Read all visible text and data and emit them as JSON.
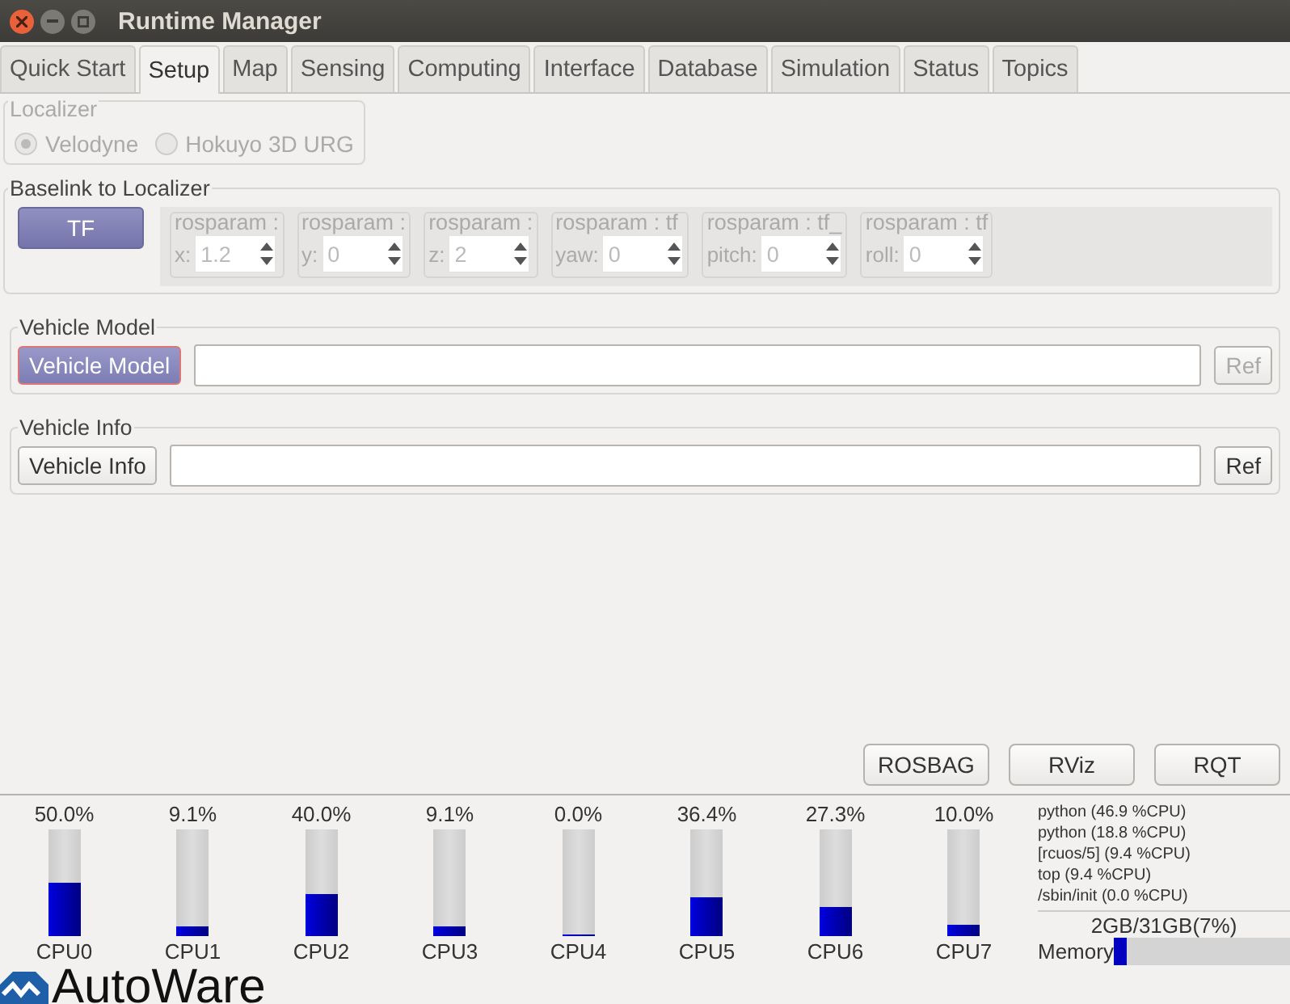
{
  "window": {
    "title": "Runtime Manager"
  },
  "tabs": [
    {
      "label": "Quick Start",
      "selected": false
    },
    {
      "label": "Setup",
      "selected": true
    },
    {
      "label": "Map",
      "selected": false
    },
    {
      "label": "Sensing",
      "selected": false
    },
    {
      "label": "Computing",
      "selected": false
    },
    {
      "label": "Interface",
      "selected": false
    },
    {
      "label": "Database",
      "selected": false
    },
    {
      "label": "Simulation",
      "selected": false
    },
    {
      "label": "Status",
      "selected": false
    },
    {
      "label": "Topics",
      "selected": false
    }
  ],
  "localizer": {
    "title": "Localizer",
    "disabled": true,
    "options": [
      {
        "label": "Velodyne",
        "selected": true
      },
      {
        "label": "Hokuyo 3D URG",
        "selected": false
      }
    ]
  },
  "baselink": {
    "title": "Baselink to Localizer",
    "button": "TF",
    "params": [
      {
        "title": "rosparam :",
        "label": "x:",
        "value": "1.2"
      },
      {
        "title": "rosparam :",
        "label": "y:",
        "value": "0"
      },
      {
        "title": "rosparam :",
        "label": "z:",
        "value": "2"
      },
      {
        "title": "rosparam : tf",
        "label": "yaw:",
        "value": "0"
      },
      {
        "title": "rosparam : tf_",
        "label": "pitch:",
        "value": "0"
      },
      {
        "title": "rosparam : tf",
        "label": "roll:",
        "value": "0"
      }
    ]
  },
  "vehicle_model": {
    "title": "Vehicle Model",
    "button": "Vehicle Model",
    "highlighted": true,
    "ref": "Ref",
    "ref_disabled": true
  },
  "vehicle_info": {
    "title": "Vehicle Info",
    "button": "Vehicle Info",
    "highlighted": false,
    "ref": "Ref",
    "ref_disabled": false
  },
  "tools": [
    "ROSBAG",
    "RViz",
    "RQT"
  ],
  "cpus": [
    {
      "percent": "50.0%",
      "level": 0.5,
      "name": "CPU0"
    },
    {
      "percent": "9.1%",
      "level": 0.091,
      "name": "CPU1"
    },
    {
      "percent": "40.0%",
      "level": 0.4,
      "name": "CPU2"
    },
    {
      "percent": "9.1%",
      "level": 0.091,
      "name": "CPU3"
    },
    {
      "percent": "0.0%",
      "level": 0,
      "name": "CPU4"
    },
    {
      "percent": "36.4%",
      "level": 0.364,
      "name": "CPU5"
    },
    {
      "percent": "27.3%",
      "level": 0.273,
      "name": "CPU6"
    },
    {
      "percent": "10.0%",
      "level": 0.1,
      "name": "CPU7"
    }
  ],
  "processes": [
    "python (46.9 %CPU)",
    "python (18.8 %CPU)",
    "[rcuos/5] (9.4 %CPU)",
    "top (9.4 %CPU)",
    "/sbin/init (0.0 %CPU)"
  ],
  "memory": {
    "reading": "2GB/31GB(7%)",
    "label": "Memory",
    "level": 0.07
  },
  "logo": "AutoWare"
}
